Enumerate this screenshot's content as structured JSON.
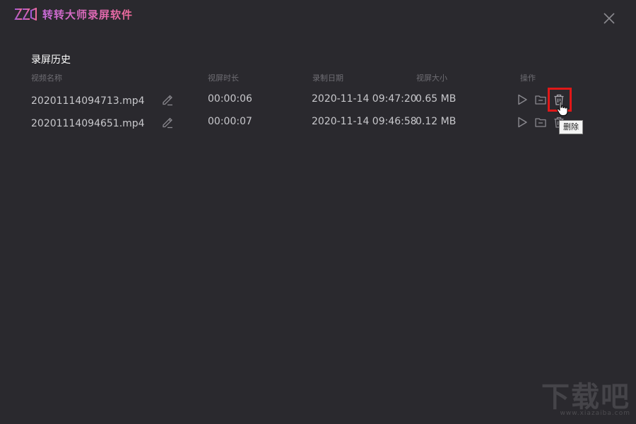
{
  "app": {
    "title": "转转大师录屏软件",
    "accent_color": "#e06ab4",
    "logo_icon": "zz-logo-icon",
    "close_icon": "close-icon"
  },
  "history": {
    "title": "录屏历史",
    "columns": {
      "name": "视频名称",
      "duration": "视屏时长",
      "date": "录制日期",
      "size": "视屏大小",
      "actions": "操作"
    },
    "rows": [
      {
        "name": "20201114094713.mp4",
        "duration": "00:00:06",
        "date": "2020-11-14 09:47:20",
        "size": "0.65 MB"
      },
      {
        "name": "20201114094651.mp4",
        "duration": "00:00:07",
        "date": "2020-11-14 09:46:58",
        "size": "0.12 MB"
      }
    ],
    "row_icons": [
      "edit-icon",
      "play-icon",
      "folder-icon",
      "trash-icon"
    ]
  },
  "tooltip": {
    "text": "删除"
  },
  "watermark": {
    "main": "下载吧",
    "sub": "www.xiazaiba.com"
  }
}
